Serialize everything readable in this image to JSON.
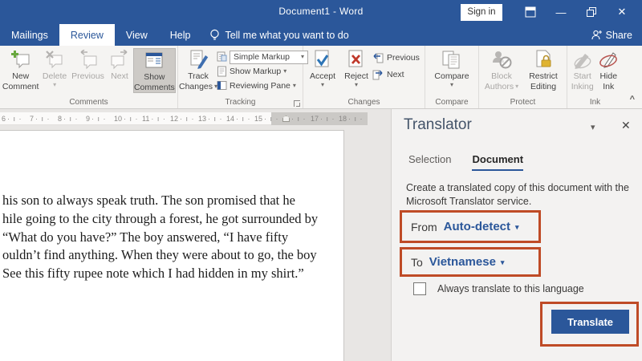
{
  "icons": {
    "dropdown": "▾",
    "close": "✕",
    "minimize": "—",
    "collapse": "^"
  },
  "titlebar": {
    "title": "Document1 - Word",
    "sign_in": "Sign in"
  },
  "tabrow": {
    "tabs": [
      {
        "label": "Mailings"
      },
      {
        "label": "Review"
      },
      {
        "label": "View"
      },
      {
        "label": "Help"
      }
    ],
    "tell_me": "Tell me what you want to do",
    "share": "Share"
  },
  "ribbon": {
    "comments": {
      "label": "Comments",
      "new_1": "New",
      "new_2": "Comment",
      "delete": "Delete",
      "previous": "Previous",
      "next": "Next",
      "show_1": "Show",
      "show_2": "Comments"
    },
    "tracking": {
      "label": "Tracking",
      "track_1": "Track",
      "track_2": "Changes",
      "simple_markup": "Simple Markup",
      "show_markup": "Show Markup",
      "reviewing_pane": "Reviewing Pane"
    },
    "changes": {
      "label": "Changes",
      "accept": "Accept",
      "reject": "Reject",
      "previous": "Previous",
      "next": "Next"
    },
    "compare": {
      "label": "Compare",
      "compare": "Compare"
    },
    "protect": {
      "label": "Protect",
      "block_1": "Block",
      "block_2": "Authors",
      "restrict_1": "Restrict",
      "restrict_2": "Editing"
    },
    "ink": {
      "label": "Ink",
      "start_1": "Start",
      "start_2": "Inking",
      "hide_1": "Hide",
      "hide_2": "Ink"
    }
  },
  "ruler": {
    "numbers": [
      "6",
      "7",
      "8",
      "9",
      "10",
      "11",
      "12",
      "13",
      "14",
      "15",
      "17",
      "18"
    ],
    "tick": "· ı ·"
  },
  "document": {
    "lines": [
      "his son to always speak truth. The son promised that he",
      "hile going to the city through a forest, he got surrounded by",
      " “What do you have?” The boy answered, “I have fifty",
      "ouldn’t find anything. When they were about to go, the boy",
      "See this fifty rupee note which I had hidden in my shirt.”"
    ]
  },
  "translator": {
    "title": "Translator",
    "tab_selection": "Selection",
    "tab_document": "Document",
    "description": "Create a translated copy of this document with the Microsoft Translator service.",
    "from_label": "From",
    "from_value": "Auto-detect",
    "to_label": "To",
    "to_value": "Vietnamese",
    "always_label": "Always translate to this language",
    "translate": "Translate"
  },
  "colors": {
    "accent": "#2B579A",
    "annotation": "#BF4B26"
  }
}
